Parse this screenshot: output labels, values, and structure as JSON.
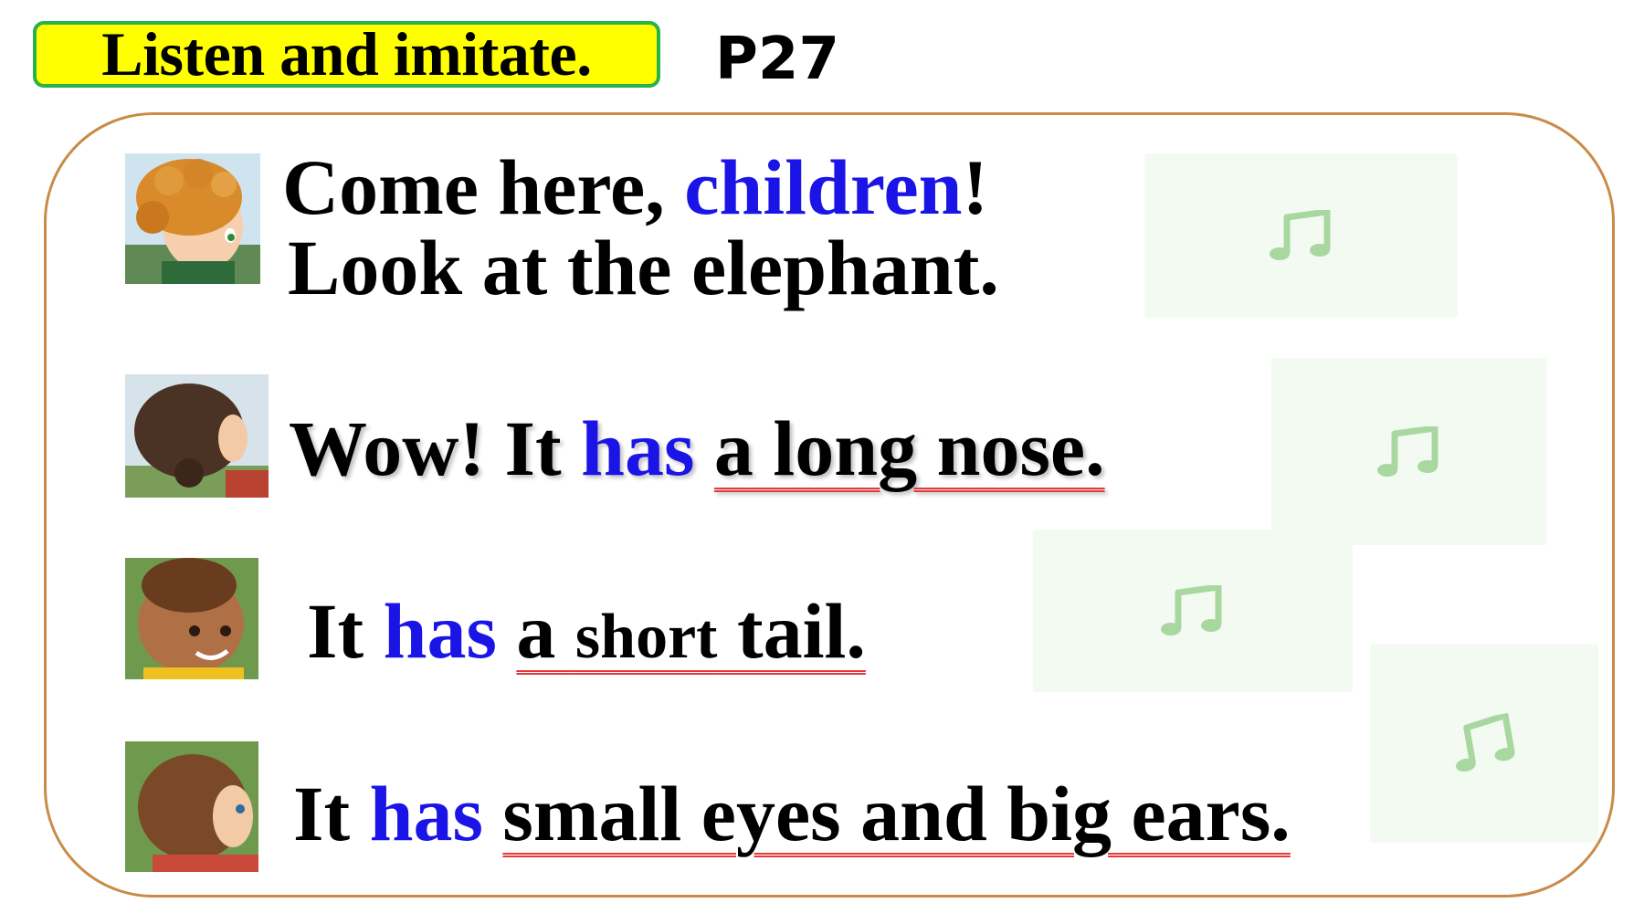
{
  "header": {
    "title": "Listen and imitate.",
    "page": "P27"
  },
  "dialogue": {
    "line1": {
      "part1": "Come here, ",
      "keyword": "children",
      "part2": "!"
    },
    "line2": {
      "text": "Look at the elephant."
    },
    "line3": {
      "part1": "Wow! It ",
      "keyword": "has",
      "part2": " ",
      "underlined": "a long nose."
    },
    "line4": {
      "part1": "It ",
      "keyword": "has",
      "part2": " ",
      "ul_a": "a ",
      "ul_b": "short",
      "ul_c": " tail."
    },
    "line5": {
      "part1": "It ",
      "keyword": "has",
      "part2": " ",
      "underlined": "small eyes and big ears."
    }
  },
  "icons": {
    "audio": "music-note-icon",
    "avatars": [
      "girl-avatar",
      "girl-back-avatar",
      "boy-avatar",
      "boy-back-avatar"
    ]
  },
  "colors": {
    "keyword": "#1a14e6",
    "underline": "#e23a3a",
    "badge": "#ffff00",
    "badge_border": "#27b24a",
    "panel_border": "#c98b48",
    "audio_bg": "#f3faf1",
    "audio_note": "#a8d8a0"
  }
}
